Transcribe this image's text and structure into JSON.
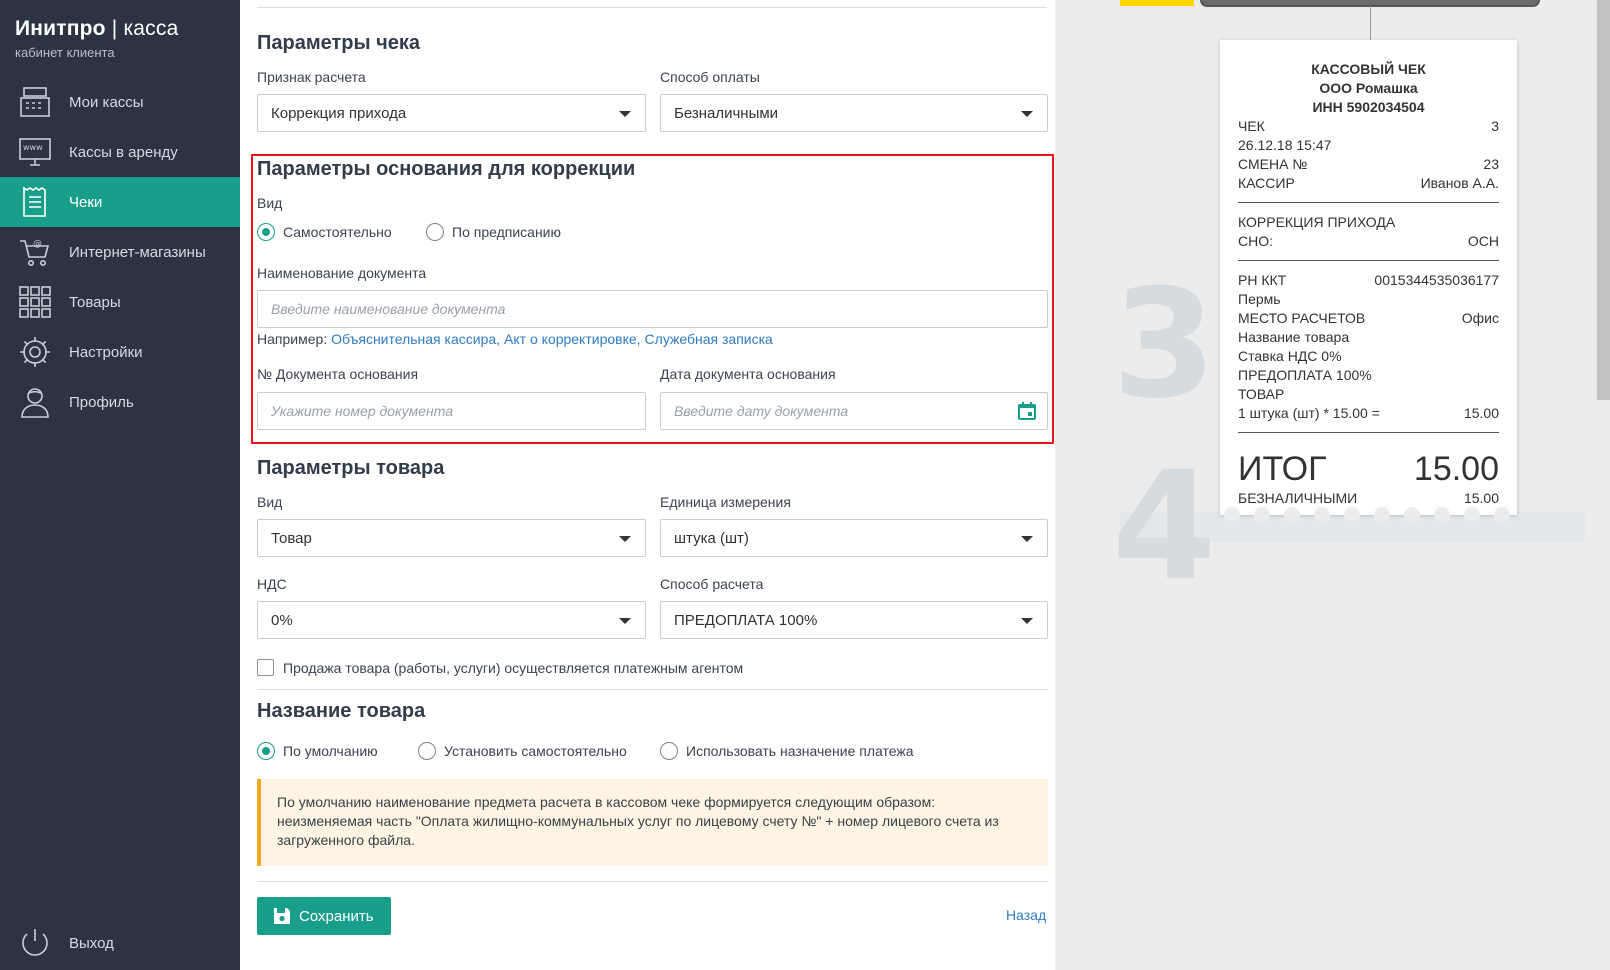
{
  "brand": {
    "title_bold": "Инитпро",
    "title_sep": " | ",
    "title_thin": "касса",
    "subtitle": "кабинет клиента"
  },
  "nav": [
    {
      "label": "Мои кассы",
      "icon": "cash-register-icon"
    },
    {
      "label": "Кассы в аренду",
      "icon": "www-monitor-icon"
    },
    {
      "label": "Чеки",
      "icon": "receipt-icon",
      "active": true
    },
    {
      "label": "Интернет-магазины",
      "icon": "cart-icon"
    },
    {
      "label": "Товары",
      "icon": "grid-icon"
    },
    {
      "label": "Настройки",
      "icon": "gear-icon"
    },
    {
      "label": "Профиль",
      "icon": "user-icon"
    }
  ],
  "logout_label": "Выход",
  "check_params": {
    "title": "Параметры чека",
    "settlement_label": "Признак расчета",
    "settlement_value": "Коррекция прихода",
    "payment_label": "Способ оплаты",
    "payment_value": "Безналичными"
  },
  "correction": {
    "title": "Параметры основания для коррекции",
    "kind_label": "Вид",
    "kind_option1": "Самостоятельно",
    "kind_option2": "По предписанию",
    "doc_name_label": "Наименование документа",
    "doc_name_placeholder": "Введите наименование документа",
    "example_label": "Например:",
    "example_links": [
      "Объяснительная кассира,",
      "Акт о корректировке,",
      "Служебная записка"
    ],
    "doc_number_label": "№ Документа основания",
    "doc_number_placeholder": "Укажите номер документа",
    "doc_date_label": "Дата документа основания",
    "doc_date_placeholder": "Введите дату документа"
  },
  "product_params": {
    "title": "Параметры товара",
    "kind_label": "Вид",
    "kind_value": "Товар",
    "unit_label": "Единица измерения",
    "unit_value": "штука (шт)",
    "vat_label": "НДС",
    "vat_value": "0%",
    "calc_label": "Способ расчета",
    "calc_value": "ПРЕДОПЛАТА 100%",
    "agent_checkbox": "Продажа товара (работы, услуги) осуществляется платежным агентом"
  },
  "product_name": {
    "title": "Название товара",
    "option1": "По умолчанию",
    "option2": "Установить самостоятельно",
    "option3": "Использовать назначение платежа",
    "note": "По умолчанию наименование предмета расчета в кассовом чеке формируется следующим образом: неизменяемая часть \"Оплата жилищно-коммунальных услуг по лицевому счету №\" + номер лицевого счета из загруженного файла."
  },
  "actions": {
    "save": "Сохранить",
    "back": "Назад"
  },
  "step_numbers": [
    "3",
    "4"
  ],
  "receipt": {
    "header": [
      "КАССОВЫЙ ЧЕК",
      "ООО Ромашка",
      "ИНН 5902034504"
    ],
    "rows1": [
      {
        "k": "ЧЕК",
        "v": "3"
      },
      {
        "k": "26.12.18 15:47",
        "v": ""
      },
      {
        "k": "СМЕНА №",
        "v": "23"
      },
      {
        "k": "КАССИР",
        "v": "Иванов А.А."
      }
    ],
    "rows2": [
      {
        "k": "КОРРЕКЦИЯ ПРИХОДА",
        "v": ""
      },
      {
        "k": "СНО:",
        "v": "ОСН"
      }
    ],
    "rows3": [
      {
        "k": "РН ККТ",
        "v": "0015344535036177"
      },
      {
        "k": "Пермь",
        "v": ""
      },
      {
        "k": "МЕСТО РАСЧЕТОВ",
        "v": "Офис"
      },
      {
        "k": "Название товара",
        "v": ""
      },
      {
        "k": "Ставка НДС 0%",
        "v": ""
      },
      {
        "k": "ПРЕДОПЛАТА 100%",
        "v": ""
      },
      {
        "k": "ТОВАР",
        "v": ""
      },
      {
        "k": "1 штука (шт) * 15.00 =",
        "v": "15.00"
      }
    ],
    "total_label": "ИТОГ",
    "total_value": "15.00",
    "payment_label": "БЕЗНАЛИЧНЫМИ",
    "payment_value": "15.00"
  },
  "colors": {
    "sidebar": "#2c3343",
    "accent": "#1a9e8c",
    "highlight": "#e8141b",
    "link": "#2f7cc1",
    "note_border": "#f5a623"
  }
}
